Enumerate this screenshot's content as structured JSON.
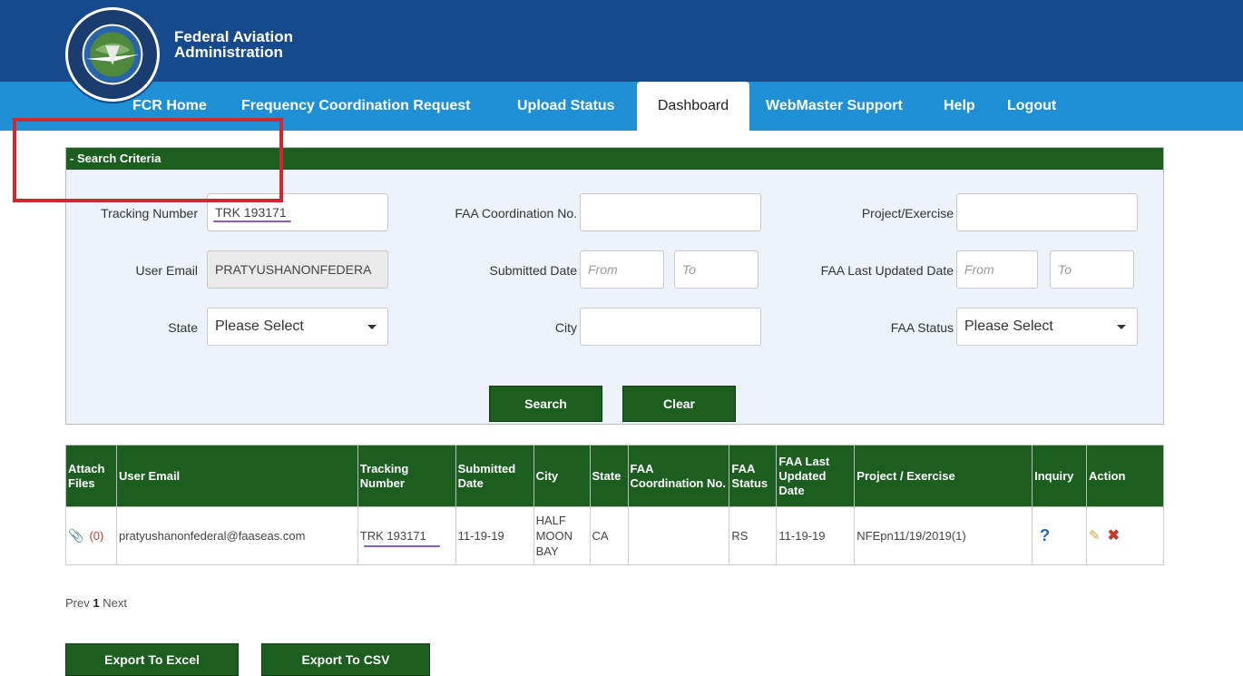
{
  "header": {
    "agency_line1": "Federal Aviation",
    "agency_line2": "Administration"
  },
  "nav": {
    "items": [
      {
        "label": "FCR Home"
      },
      {
        "label": "Frequency Coordination Request"
      },
      {
        "label": "Upload Status"
      },
      {
        "label": "Dashboard",
        "active": true
      },
      {
        "label": "WebMaster Support"
      },
      {
        "label": "Help"
      },
      {
        "label": "Logout"
      }
    ]
  },
  "search": {
    "title": "- Search Criteria",
    "tracking_number_label": "Tracking Number",
    "tracking_number_value": "TRK 193171",
    "faa_coord_label": "FAA Coordination No.",
    "faa_coord_value": "",
    "project_label": "Project/Exercise",
    "project_value": "",
    "user_email_label": "User Email",
    "user_email_value": "PRATYUSHANONFEDERA",
    "submitted_date_label": "Submitted Date",
    "from_placeholder": "From",
    "to_placeholder": "To",
    "faa_last_updated_label": "FAA Last Updated Date",
    "state_label": "State",
    "state_value": "Please Select",
    "city_label": "City",
    "city_value": "",
    "faa_status_label": "FAA Status",
    "faa_status_value": "Please Select",
    "search_button": "Search",
    "clear_button": "Clear"
  },
  "table": {
    "headers": {
      "attach": "Attach Files",
      "user_email": "User Email",
      "tracking": "Tracking Number",
      "submitted": "Submitted Date",
      "city": "City",
      "state": "State",
      "faa_coord": "FAA Coordination No.",
      "faa_status": "FAA Status",
      "faa_last": "FAA Last Updated Date",
      "project": "Project / Exercise",
      "inquiry": "Inquiry",
      "action": "Action"
    },
    "rows": [
      {
        "attach_count": "(0)",
        "user_email": "pratyushanonfederal@faaseas.com",
        "tracking": "TRK 193171",
        "submitted": "11-19-19",
        "city": "HALF MOON BAY",
        "state": "CA",
        "faa_coord": "",
        "faa_status": "RS",
        "faa_last": "11-19-19",
        "project": "NFEpn11/19/2019(1)",
        "inquiry": "?"
      }
    ]
  },
  "pager": {
    "prev": "Prev",
    "current": "1",
    "next": "Next"
  },
  "export": {
    "excel": "Export To Excel",
    "csv": "Export To CSV"
  },
  "colors": {
    "header_blue": "#164a8c",
    "nav_blue": "#1f8fd6",
    "green": "#1c5e20",
    "annotation_red": "#cc2a30",
    "annotation_purple": "#8a5cc9"
  }
}
